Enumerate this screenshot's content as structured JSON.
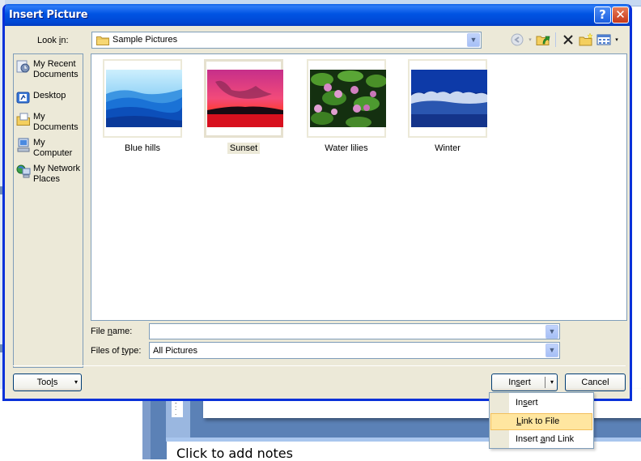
{
  "background": {
    "notes_placeholder": "Click to add notes",
    "ruler_marks": "- : ."
  },
  "dialog": {
    "title": "Insert Picture",
    "help_button": "?",
    "close_button": "✕",
    "look_in": {
      "label": "Look in:",
      "value": "Sample Pictures",
      "dropdown_arrow": "⌄"
    },
    "toolbar": {
      "back": "back-icon",
      "up_one_level": "up-folder-icon",
      "delete": "delete-icon",
      "new_folder": "new-folder-icon",
      "views": "views-icon",
      "views_dropdown": "▾",
      "back_dropdown": "▾"
    },
    "places": [
      {
        "label": "My Recent Documents",
        "icon": "recent-documents-icon"
      },
      {
        "label": "Desktop",
        "icon": "desktop-icon"
      },
      {
        "label": "My Documents",
        "icon": "my-documents-icon"
      },
      {
        "label": "My Computer",
        "icon": "my-computer-icon"
      },
      {
        "label": "My Network Places",
        "icon": "network-places-icon"
      }
    ],
    "files": [
      {
        "name": "Blue hills",
        "selected": false
      },
      {
        "name": "Sunset",
        "selected": true
      },
      {
        "name": "Water lilies",
        "selected": false
      },
      {
        "name": "Winter",
        "selected": false
      }
    ],
    "file_name": {
      "label": "File name:",
      "value": ""
    },
    "files_of_type": {
      "label": "Files of type:",
      "value": "All Pictures"
    },
    "buttons": {
      "tools": "Tools",
      "insert": "Insert",
      "cancel": "Cancel",
      "dropdown_arrow": "▾"
    },
    "insert_menu": [
      {
        "label": "Insert",
        "highlighted": false
      },
      {
        "label": "Link to File",
        "highlighted": true
      },
      {
        "label": "Insert and Link",
        "highlighted": false
      }
    ]
  },
  "colors": {
    "titlebar": "#0054e3",
    "dialog_bg": "#ece9d8",
    "border": "#7f9db9",
    "menu_highlight": "#ffe6a0",
    "menu_highlight_border": "#f2bf5c"
  }
}
